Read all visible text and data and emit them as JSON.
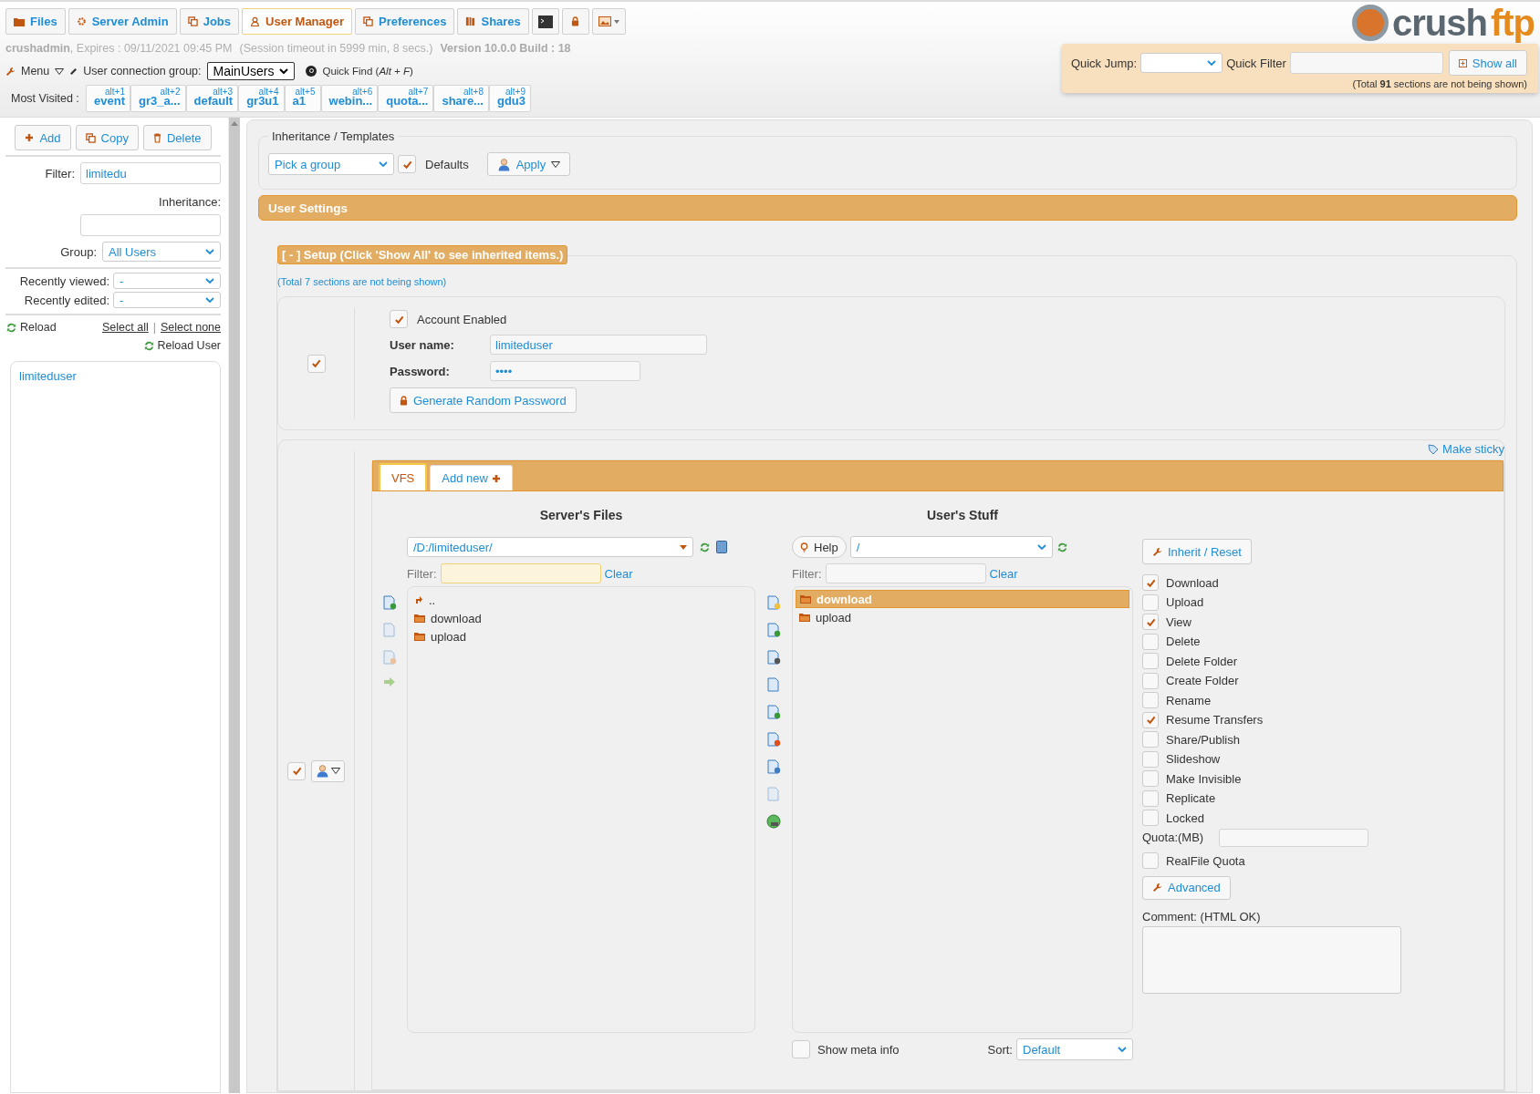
{
  "top_tabs": [
    {
      "label": "Files",
      "selected": false
    },
    {
      "label": "Server Admin",
      "selected": false
    },
    {
      "label": "Jobs",
      "selected": false
    },
    {
      "label": "User Manager",
      "selected": true
    },
    {
      "label": "Preferences",
      "selected": false
    },
    {
      "label": "Shares",
      "selected": false
    }
  ],
  "session": {
    "user": "crushadmin",
    "expires_label": ", Expires :",
    "expires": "09/11/2021 09:45 PM",
    "timeout": "(Session timeout in 5999 min, 8 secs.)",
    "version": "Version 10.0.0 Build : 18"
  },
  "toolbar": {
    "menu": "Menu",
    "connection_group_label": "User connection group:",
    "connection_group": "MainUsers",
    "quick_find": "Quick Find (*Alt + F*)"
  },
  "most_visited": {
    "label": "Most Visited :",
    "items": [
      {
        "shortcut": "alt+1",
        "label": "event"
      },
      {
        "shortcut": "alt+2",
        "label": "gr3_a..."
      },
      {
        "shortcut": "alt+3",
        "label": "default"
      },
      {
        "shortcut": "alt+4",
        "label": "gr3u1"
      },
      {
        "shortcut": "alt+5",
        "label": "a1"
      },
      {
        "shortcut": "alt+6",
        "label": "webin..."
      },
      {
        "shortcut": "alt+7",
        "label": "quota..."
      },
      {
        "shortcut": "alt+8",
        "label": "share..."
      },
      {
        "shortcut": "alt+9",
        "label": "gdu3"
      }
    ]
  },
  "logo": {
    "part_1": "crush",
    "part_2": "ftp"
  },
  "quick_panel": {
    "jump_label": "Quick Jump:",
    "filter_label": "Quick Filter",
    "show_all": "Show all",
    "note": "(Total **91** sections are not being shown)"
  },
  "sidebar": {
    "buttons": [
      "Add",
      "Copy",
      "Delete"
    ],
    "filter_label": "Filter:",
    "filter_value": "limitedu",
    "inheritance_label": "Inheritance:",
    "group_label": "Group:",
    "group_value": "All Users",
    "recently_viewed_label": "Recently viewed:",
    "recently_viewed_value": "-",
    "recently_edited_label": "Recently edited:",
    "recently_edited_value": "-",
    "reload": "Reload",
    "select_all": "Select all",
    "separator": "|",
    "select_none": "Select none",
    "reload_user": "Reload User",
    "users": [
      {
        "name": "limiteduser",
        "selected": false
      }
    ]
  },
  "inheritance": {
    "title": "Inheritance / Templates",
    "group_placeholder": "Pick a group",
    "defaults_checked": true,
    "defaults_label": "Defaults",
    "apply": "Apply"
  },
  "user_settings_title": "User Settings",
  "setup": {
    "legend": "[ - ] Setup (Click 'Show All' to see inherited items.)",
    "note": "(Total 7 sections are not being shown)",
    "row_checked": true,
    "account_enabled_label": "Account Enabled",
    "account_enabled": true,
    "username_label": "User name:",
    "username": "limiteduser",
    "password_label": "Password:",
    "password": "••••",
    "generate_button": "Generate Random Password"
  },
  "vfs": {
    "make_sticky": "Make sticky",
    "row_checked": true,
    "tabs": [
      {
        "label": "VFS",
        "selected": true,
        "kind": "tab"
      },
      {
        "label": "Add new",
        "selected": false,
        "kind": "add"
      }
    ],
    "server": {
      "title": "Server's Files",
      "path": "/D:/limiteduser/",
      "filter_label": "Filter:",
      "clear": "Clear",
      "items": [
        {
          "kind": "up",
          "name": ".."
        },
        {
          "kind": "folder",
          "name": "download"
        },
        {
          "kind": "folder",
          "name": "upload"
        }
      ]
    },
    "user": {
      "title": "User's Stuff",
      "help": "Help",
      "path": "/",
      "filter_label": "Filter:",
      "clear": "Clear",
      "items": [
        {
          "name": "download",
          "selected": true
        },
        {
          "name": "upload",
          "selected": false
        }
      ],
      "show_meta_label": "Show meta info",
      "show_meta_checked": false,
      "sort_label": "Sort:",
      "sort_value": "Default"
    },
    "inherit_reset": "Inherit / Reset",
    "permissions": [
      {
        "label": "Download",
        "checked": true
      },
      {
        "label": "Upload",
        "checked": false
      },
      {
        "label": "View",
        "checked": true
      },
      {
        "label": "Delete",
        "checked": false
      },
      {
        "label": "Delete Folder",
        "checked": false
      },
      {
        "label": "Create Folder",
        "checked": false
      },
      {
        "label": "Rename",
        "checked": false
      },
      {
        "label": "Resume Transfers",
        "checked": true
      },
      {
        "label": "Share/Publish",
        "checked": false
      },
      {
        "label": "Slideshow",
        "checked": false
      },
      {
        "label": "Make Invisible",
        "checked": false
      },
      {
        "label": "Replicate",
        "checked": false
      },
      {
        "label": "Locked",
        "checked": false
      }
    ],
    "quota_label": "Quota:(MB)",
    "realfile_quota_label": "RealFile Quota",
    "realfile_quota_checked": false,
    "advanced": "Advanced",
    "comment_label": "Comment: (HTML OK)"
  }
}
